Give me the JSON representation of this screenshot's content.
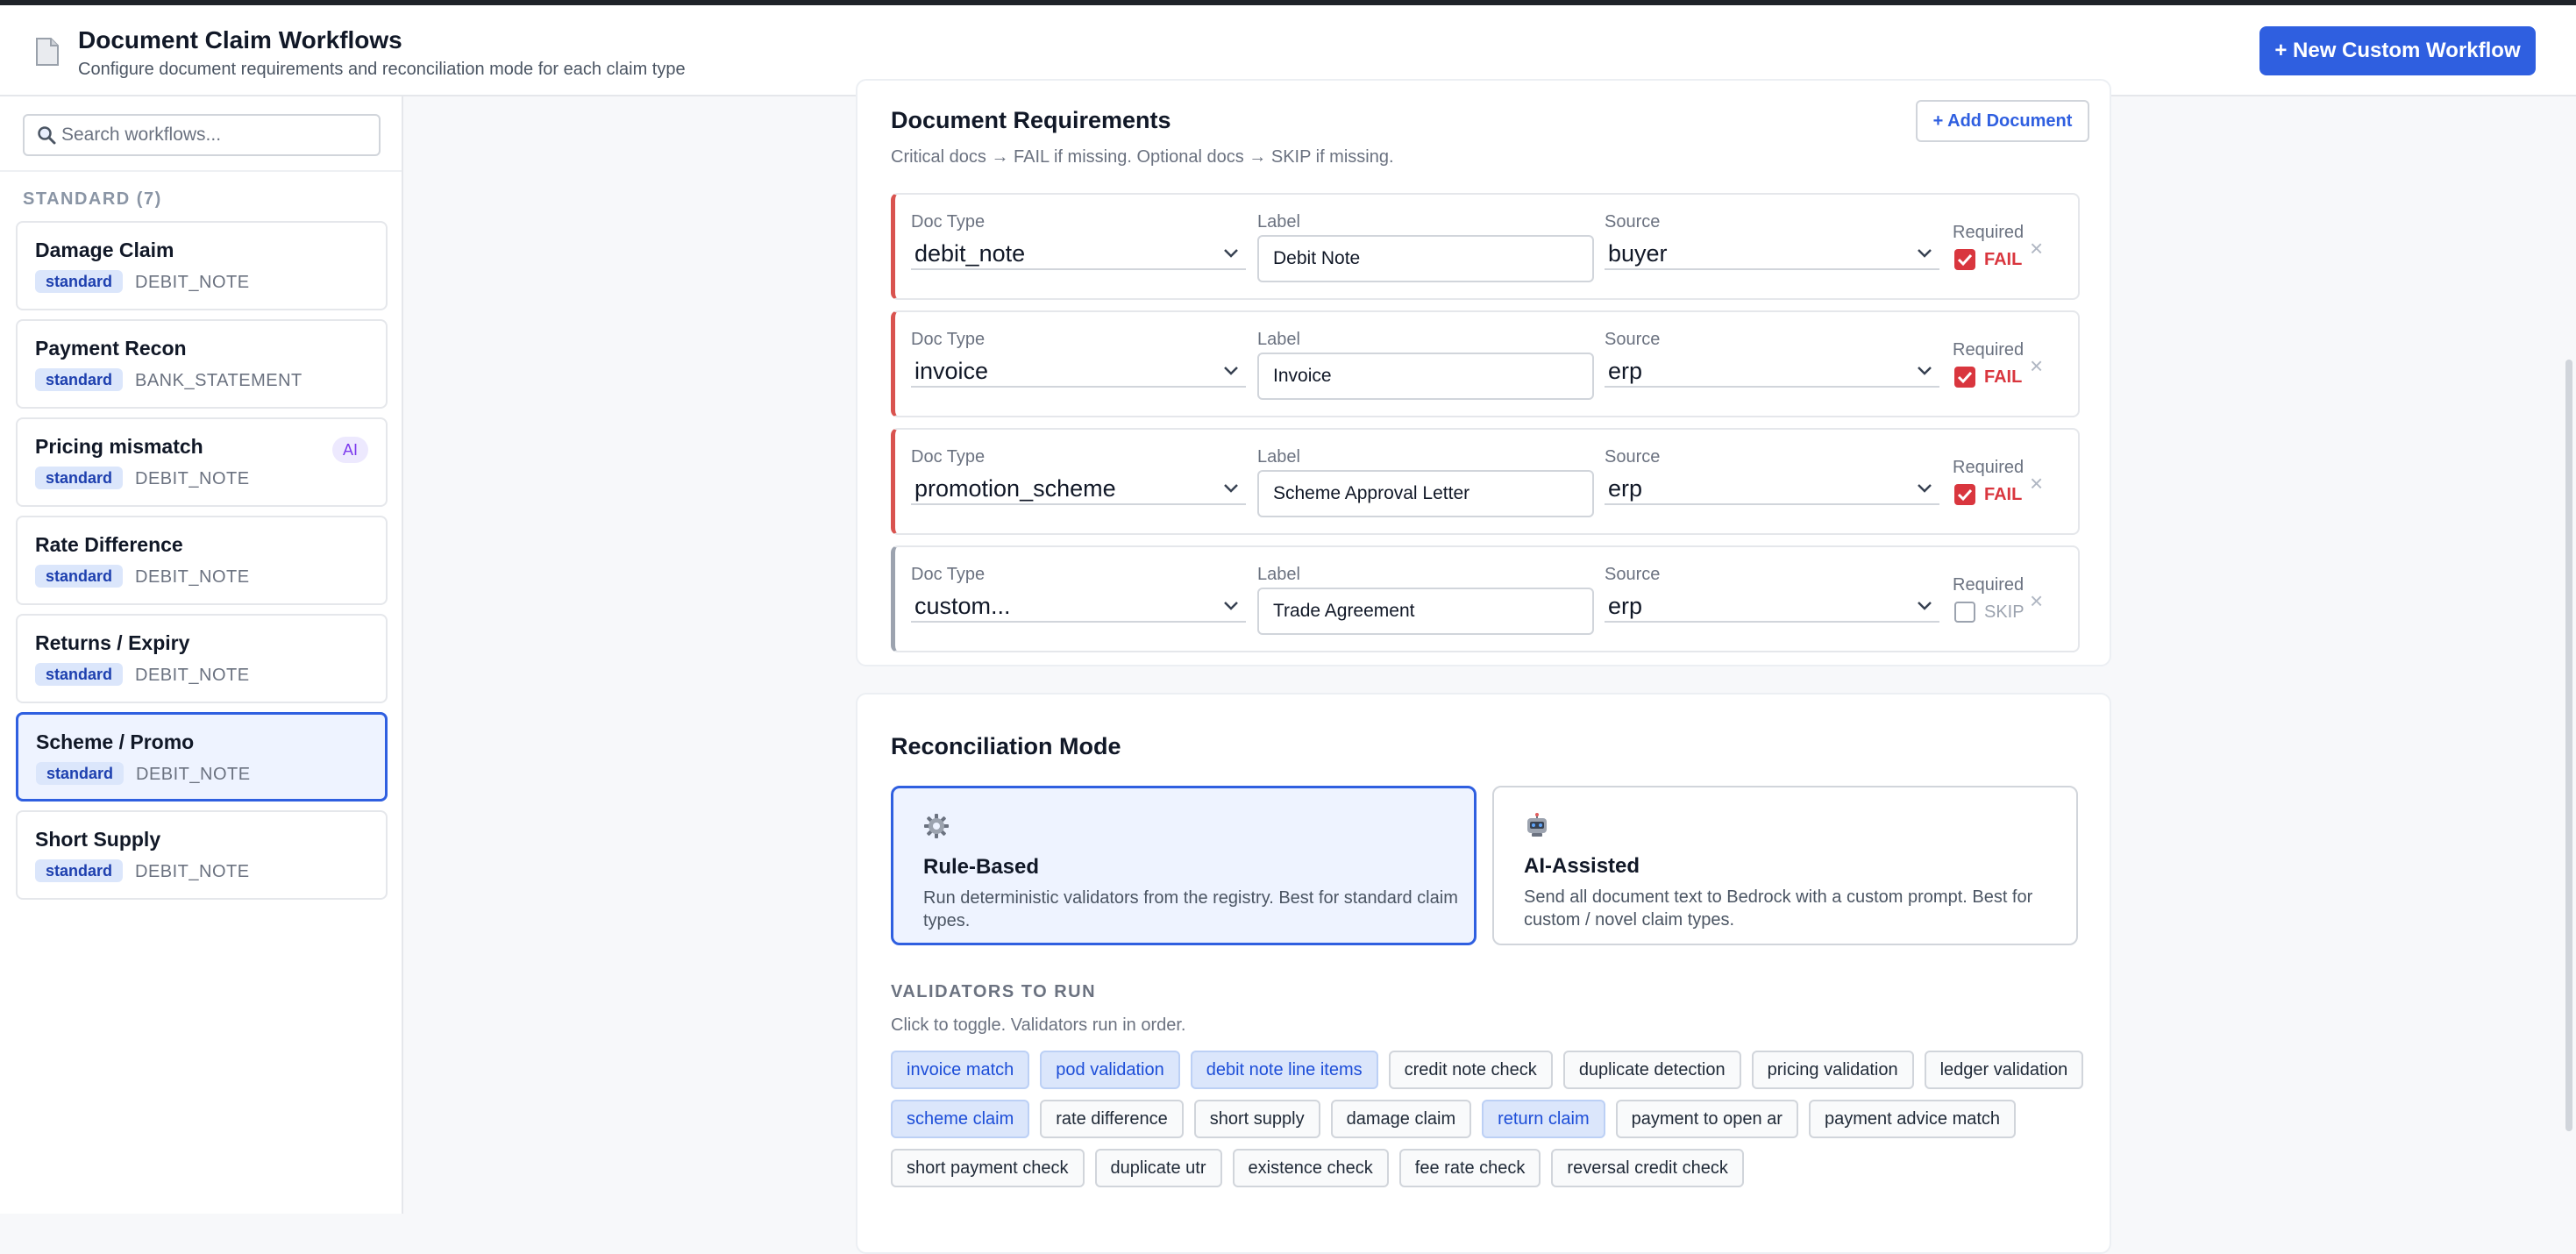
{
  "header": {
    "title": "Document Claim Workflows",
    "subtitle": "Configure document requirements and reconciliation mode for each claim type",
    "new_button": "+ New Custom Workflow"
  },
  "sidebar": {
    "search_placeholder": "Search workflows...",
    "section_label": "STANDARD (7)",
    "items": [
      {
        "name": "Damage Claim",
        "badge": "standard",
        "doc_type": "DEBIT_NOTE",
        "ai": false,
        "active": false
      },
      {
        "name": "Payment Recon",
        "badge": "standard",
        "doc_type": "BANK_STATEMENT",
        "ai": false,
        "active": false
      },
      {
        "name": "Pricing mismatch",
        "badge": "standard",
        "doc_type": "DEBIT_NOTE",
        "ai": true,
        "ai_label": "AI",
        "active": false
      },
      {
        "name": "Rate Difference",
        "badge": "standard",
        "doc_type": "DEBIT_NOTE",
        "ai": false,
        "active": false
      },
      {
        "name": "Returns / Expiry",
        "badge": "standard",
        "doc_type": "DEBIT_NOTE",
        "ai": false,
        "active": false
      },
      {
        "name": "Scheme / Promo",
        "badge": "standard",
        "doc_type": "DEBIT_NOTE",
        "ai": false,
        "active": true
      },
      {
        "name": "Short Supply",
        "badge": "standard",
        "doc_type": "DEBIT_NOTE",
        "ai": false,
        "active": false
      }
    ]
  },
  "docs": {
    "title": "Document Requirements",
    "subtitle": "Critical docs → FAIL if missing. Optional docs → SKIP if missing.",
    "add_button": "+ Add Document",
    "field_labels": {
      "doc_type": "Doc Type",
      "label": "Label",
      "source": "Source",
      "required": "Required"
    },
    "remove_glyph": "×",
    "rows": [
      {
        "doc_type": "debit_note",
        "label": "Debit Note",
        "source": "buyer",
        "required": true,
        "state": "FAIL"
      },
      {
        "doc_type": "invoice",
        "label": "Invoice",
        "source": "erp",
        "required": true,
        "state": "FAIL"
      },
      {
        "doc_type": "promotion_scheme",
        "label": "Scheme Approval Letter",
        "source": "erp",
        "required": true,
        "state": "FAIL"
      },
      {
        "doc_type": "custom...",
        "label": "Trade Agreement",
        "source": "erp",
        "required": false,
        "state": "SKIP"
      }
    ]
  },
  "recon": {
    "title": "Reconciliation Mode",
    "modes": [
      {
        "icon": "gear-icon",
        "title": "Rule-Based",
        "desc": "Run deterministic validators from the registry. Best for standard claim types.",
        "active": true
      },
      {
        "icon": "robot-icon",
        "title": "AI-Assisted",
        "desc": "Send all document text to Bedrock with a custom prompt. Best for custom / novel claim types.",
        "active": false
      }
    ],
    "validators_label": "VALIDATORS TO RUN",
    "validators_sub": "Click to toggle. Validators run in order.",
    "validators": [
      {
        "name": "invoice match",
        "on": true
      },
      {
        "name": "pod validation",
        "on": true
      },
      {
        "name": "debit note line items",
        "on": true
      },
      {
        "name": "credit note check",
        "on": false
      },
      {
        "name": "duplicate detection",
        "on": false
      },
      {
        "name": "pricing validation",
        "on": false
      },
      {
        "name": "ledger validation",
        "on": false
      },
      {
        "name": "scheme claim",
        "on": true
      },
      {
        "name": "rate difference",
        "on": false
      },
      {
        "name": "short supply",
        "on": false
      },
      {
        "name": "damage claim",
        "on": false
      },
      {
        "name": "return claim",
        "on": true
      },
      {
        "name": "payment to open ar",
        "on": false
      },
      {
        "name": "payment advice match",
        "on": false
      },
      {
        "name": "short payment check",
        "on": false
      },
      {
        "name": "duplicate utr",
        "on": false
      },
      {
        "name": "existence check",
        "on": false
      },
      {
        "name": "fee rate check",
        "on": false
      },
      {
        "name": "reversal credit check",
        "on": false
      }
    ]
  },
  "colors": {
    "accent": "#2f5fe0",
    "fail": "#d9363e",
    "active_bg": "#eef3ff",
    "chip_on_bg": "#dbe6fb"
  }
}
